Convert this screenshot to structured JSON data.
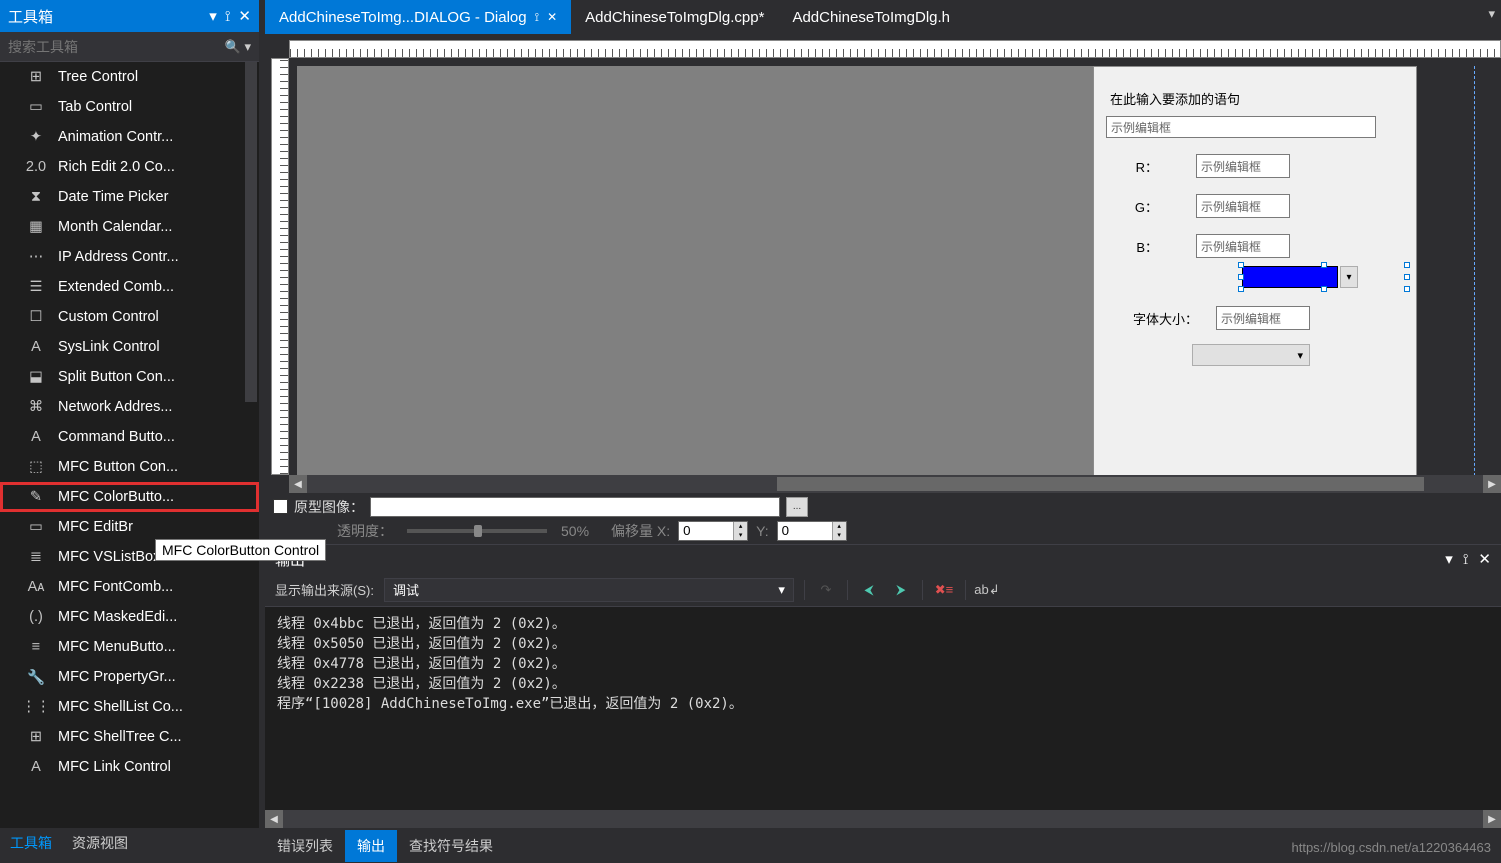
{
  "toolbox": {
    "title": "工具箱",
    "search_placeholder": "搜索工具箱",
    "items": [
      {
        "label": "Tree Control",
        "icon": "tree"
      },
      {
        "label": "Tab Control",
        "icon": "tab"
      },
      {
        "label": "Animation Contr...",
        "icon": "star"
      },
      {
        "label": "Rich Edit 2.0 Co...",
        "icon": "richedit"
      },
      {
        "label": "Date Time Picker",
        "icon": "datetime"
      },
      {
        "label": "Month Calendar...",
        "icon": "calendar"
      },
      {
        "label": "IP Address Contr...",
        "icon": "ip"
      },
      {
        "label": "Extended Comb...",
        "icon": "combo"
      },
      {
        "label": "Custom Control",
        "icon": "custom"
      },
      {
        "label": "SysLink Control",
        "icon": "link"
      },
      {
        "label": "Split Button Con...",
        "icon": "split"
      },
      {
        "label": "Network Addres...",
        "icon": "network"
      },
      {
        "label": "Command Butto...",
        "icon": "cmd"
      },
      {
        "label": "MFC Button Con...",
        "icon": "mfcbtn"
      },
      {
        "label": "MFC ColorButto...",
        "icon": "colorbtn",
        "highlighted": true
      },
      {
        "label": "MFC EditBr",
        "icon": "editbr"
      },
      {
        "label": "MFC VSListBox C...",
        "icon": "vslist"
      },
      {
        "label": "MFC FontComb...",
        "icon": "fontcombo"
      },
      {
        "label": "MFC MaskedEdi...",
        "icon": "masked"
      },
      {
        "label": "MFC MenuButto...",
        "icon": "menubtn"
      },
      {
        "label": "MFC PropertyGr...",
        "icon": "propgrid"
      },
      {
        "label": "MFC ShellList Co...",
        "icon": "shelllist"
      },
      {
        "label": "MFC ShellTree C...",
        "icon": "shelltree"
      },
      {
        "label": "MFC Link Control",
        "icon": "mfclink"
      }
    ],
    "tooltip": "MFC ColorButton Control",
    "bottom_tabs": {
      "toolbox": "工具箱",
      "resource_view": "资源视图"
    }
  },
  "doc_tabs": [
    {
      "label": "AddChineseToImg...DIALOG - Dialog",
      "active": true,
      "pinned": true
    },
    {
      "label": "AddChineseToImgDlg.cpp*"
    },
    {
      "label": "AddChineseToImgDlg.h"
    }
  ],
  "dialog_form": {
    "prompt_label": "在此输入要添加的语句",
    "main_edit": "示例编辑框",
    "r_label": "R：",
    "r_value": "示例编辑框",
    "g_label": "G：",
    "g_value": "示例编辑框",
    "b_label": "B：",
    "b_value": "示例编辑框",
    "color_hex": "#0000ff",
    "font_size_label": "字体大小：",
    "font_size_value": "示例编辑框"
  },
  "proto": {
    "checkbox_label": "原型图像：",
    "opacity_label": "透明度：",
    "opacity_pct": "50%",
    "offset_x_label": "偏移量 X:",
    "offset_x": "0",
    "offset_y_label": "Y:",
    "offset_y": "0"
  },
  "output": {
    "title": "输出",
    "source_label": "显示输出来源(S):",
    "source_value": "调试",
    "lines": "线程 0x4bbc 已退出，返回值为 2 (0x2)。\n线程 0x5050 已退出，返回值为 2 (0x2)。\n线程 0x4778 已退出，返回值为 2 (0x2)。\n线程 0x2238 已退出，返回值为 2 (0x2)。\n程序“[10028] AddChineseToImg.exe”已退出，返回值为 2 (0x2)。"
  },
  "bottom_tabs": {
    "error_list": "错误列表",
    "output": "输出",
    "find_results": "查找符号结果"
  },
  "watermark": "https://blog.csdn.net/a1220364463"
}
